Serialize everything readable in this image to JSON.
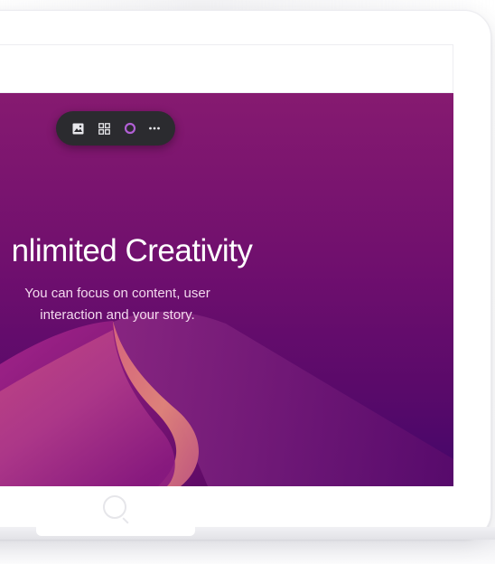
{
  "hero": {
    "title": "nlimited Creativity",
    "subtitle_line1": "You can focus on content, user",
    "subtitle_line2": "interaction and your story."
  },
  "toolbar": {
    "tools": [
      "image-icon",
      "grid-icon",
      "color-circle-icon",
      "more-icon"
    ],
    "more_label": "···",
    "accent_color": "#b15fd4"
  },
  "screen": {
    "gradient_top": "#861a70",
    "gradient_bottom": "#43066a"
  }
}
